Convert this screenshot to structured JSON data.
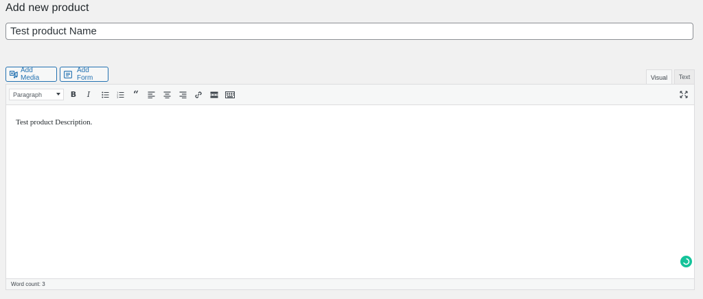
{
  "page": {
    "title": "Add new product"
  },
  "product": {
    "name_value": "Test product Name"
  },
  "media_buttons": {
    "add_media_label": "Add Media",
    "add_form_label": "Add Form"
  },
  "editor_tabs": {
    "visual_label": "Visual",
    "text_label": "Text",
    "active": "Visual"
  },
  "toolbar": {
    "format_selected": "Paragraph",
    "buttons": [
      "bold-icon",
      "italic-icon",
      "bulleted-list-icon",
      "numbered-list-icon",
      "blockquote-icon",
      "align-left-icon",
      "align-center-icon",
      "align-right-icon",
      "link-icon",
      "read-more-icon",
      "toolbar-toggle-icon",
      "fullscreen-icon"
    ]
  },
  "editor": {
    "content": "Test product Description."
  },
  "status": {
    "word_count_label": "Word count: 3"
  },
  "colors": {
    "accent": "#2271b1",
    "grammar_status": "#15c39a"
  }
}
